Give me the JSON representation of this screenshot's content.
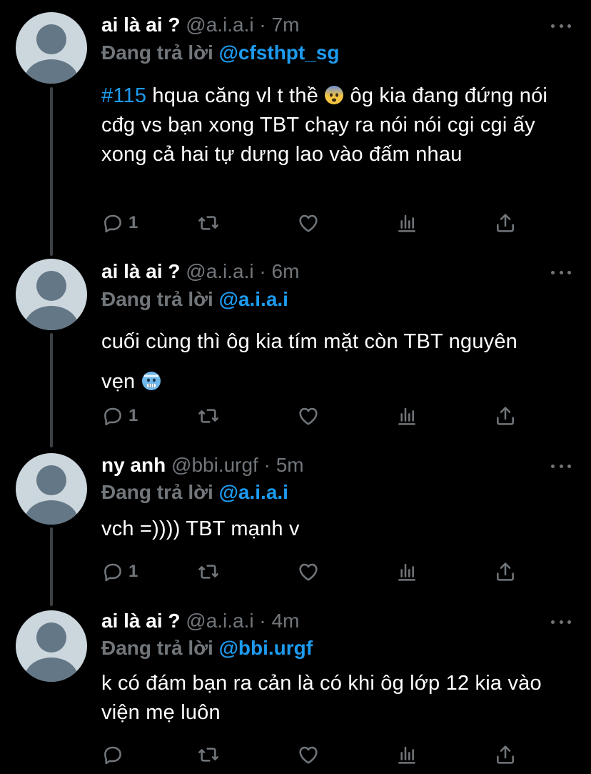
{
  "colors": {
    "background": "#000000",
    "accent": "#1d9bf0",
    "muted": "#71767b",
    "text": "#ffffff"
  },
  "tweets": [
    {
      "name": "ai là ai ?",
      "handle": "@a.i.a.i",
      "dot": "·",
      "time": "7m",
      "reply_prefix": "Đang trả lời",
      "reply_to": "@cfsthpt_sg",
      "hashtag": "#115",
      "text_after_hashtag": " hqua căng vl t thề ",
      "emoji": "anxious-face-emoji",
      "text_after_emoji": " ôg kia đang đứng nói cđg vs bạn xong TBT chạy ra nói nói cgi cgi ấy xong cả hai tự dưng lao vào đấm nhau",
      "reply_count": "1"
    },
    {
      "name": "ai là ai ?",
      "handle": "@a.i.a.i",
      "dot": "·",
      "time": "6m",
      "reply_prefix": "Đang trả lời",
      "reply_to": "@a.i.a.i",
      "text": "cuối cùng thì ôg kia tím mặt còn TBT nguyên vẹn ",
      "emoji": "cold-face-emoji",
      "reply_count": "1"
    },
    {
      "name": "ny anh",
      "handle": "@bbi.urgf",
      "dot": "·",
      "time": "5m",
      "reply_prefix": "Đang trả lời",
      "reply_to": "@a.i.a.i",
      "text": "vch =)))) TBT mạnh v",
      "reply_count": "1"
    },
    {
      "name": "ai là ai ?",
      "handle": "@a.i.a.i",
      "dot": "·",
      "time": "4m",
      "reply_prefix": "Đang trả lời",
      "reply_to": "@bbi.urgf",
      "text": "k có đám bạn ra cản là có khi ôg lớp 12 kia vào viện mẹ luôn",
      "reply_count": ""
    }
  ],
  "icons": [
    "reply-icon",
    "retweet-icon",
    "like-icon",
    "analytics-icon",
    "share-icon",
    "more-icon"
  ]
}
